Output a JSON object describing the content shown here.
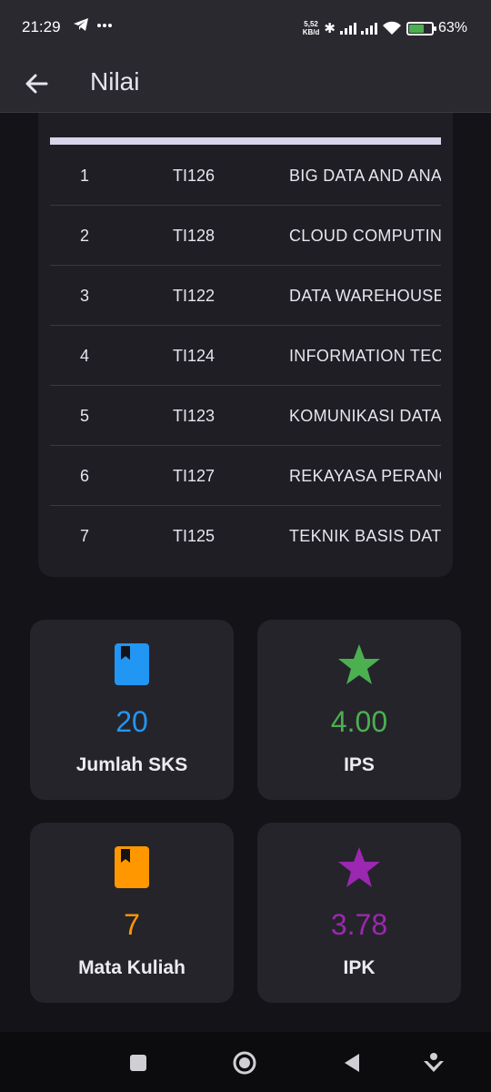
{
  "status_bar": {
    "time": "21:29",
    "left_icons": [
      "telegram-icon",
      "more-dots-icon"
    ],
    "speed_value": "5,52",
    "speed_unit": "KB/d",
    "battery_percent": "63%"
  },
  "app_bar": {
    "title": "Nilai",
    "back_icon": "arrow-left-icon"
  },
  "table": {
    "rows": [
      {
        "no": "1",
        "code": "TI126",
        "name": "BIG DATA AND ANA"
      },
      {
        "no": "2",
        "code": "TI128",
        "name": "CLOUD COMPUTIN"
      },
      {
        "no": "3",
        "code": "TI122",
        "name": "DATA WAREHOUSE"
      },
      {
        "no": "4",
        "code": "TI124",
        "name": "INFORMATION TEC"
      },
      {
        "no": "5",
        "code": "TI123",
        "name": "KOMUNIKASI DATA"
      },
      {
        "no": "6",
        "code": "TI127",
        "name": "REKAYASA PERANC"
      },
      {
        "no": "7",
        "code": "TI125",
        "name": "TEKNIK BASIS DAT"
      }
    ]
  },
  "stats": {
    "sks": {
      "value": "20",
      "label": "Jumlah SKS",
      "icon": "bookmark-book-icon",
      "color": "#2196f3"
    },
    "ips": {
      "value": "4.00",
      "label": "IPS",
      "icon": "star-icon",
      "color": "#4caf50"
    },
    "matkul": {
      "value": "7",
      "label": "Mata Kuliah",
      "icon": "bookmark-book-icon",
      "color": "#ff9800"
    },
    "ipk": {
      "value": "3.78",
      "label": "IPK",
      "icon": "star-icon",
      "color": "#9c27b0"
    }
  },
  "nav_bar": {
    "buttons": [
      "recents-square-icon",
      "home-circle-icon",
      "back-triangle-icon",
      "assistant-icon"
    ]
  }
}
